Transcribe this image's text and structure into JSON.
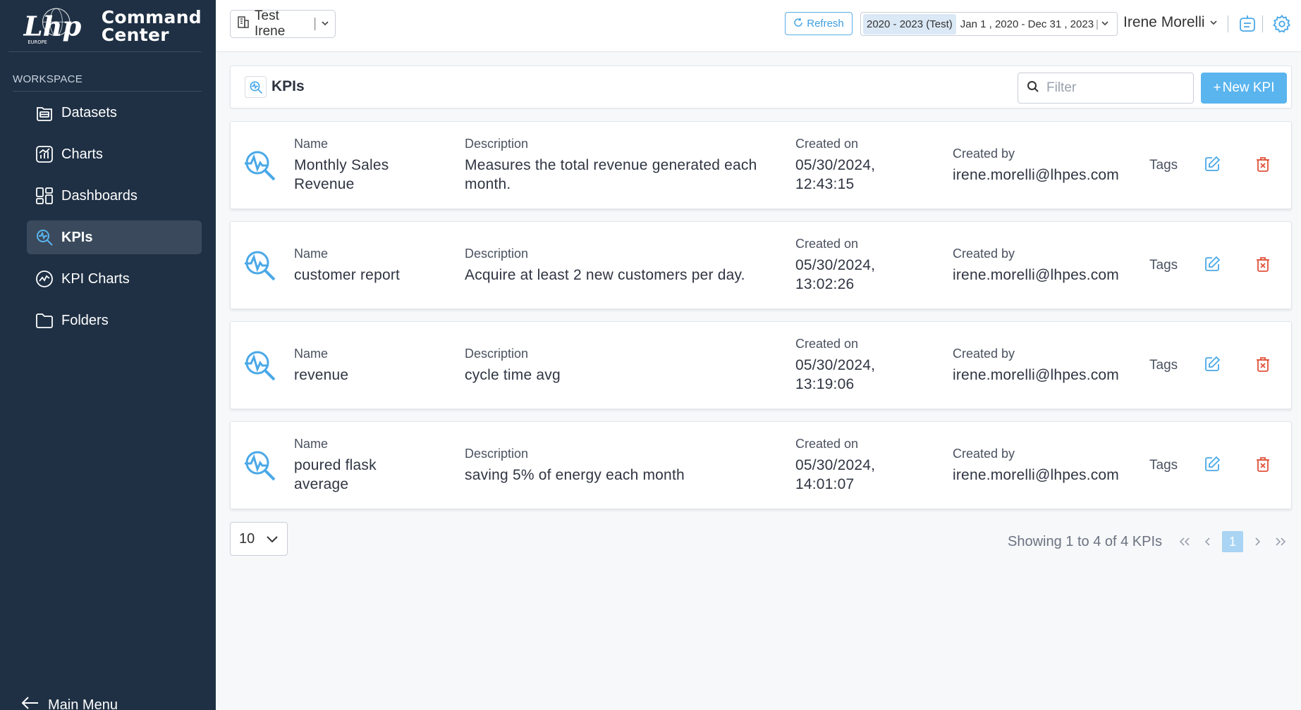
{
  "app": {
    "brand": [
      "Command",
      "Center"
    ],
    "logo_text": "Lhp EUROPE"
  },
  "sidebar": {
    "section_label": "WORKSPACE",
    "items": [
      {
        "label": "Datasets",
        "icon": "datasets-icon",
        "active": false
      },
      {
        "label": "Charts",
        "icon": "chart-icon",
        "active": false
      },
      {
        "label": "Dashboards",
        "icon": "dashboard-icon",
        "active": false
      },
      {
        "label": "KPIs",
        "icon": "kpi-icon",
        "active": true
      },
      {
        "label": "KPI Charts",
        "icon": "kpi-chart-icon",
        "active": false
      },
      {
        "label": "Folders",
        "icon": "folder-icon",
        "active": false
      }
    ],
    "main_menu": "Main Menu"
  },
  "topbar": {
    "tenant": "Test Irene",
    "refresh": "Refresh",
    "range_badge": "2020 - 2023 (Test)",
    "range_dates": "Jan 1 , 2020 - Dec 31 , 2023",
    "user": "Irene Morelli"
  },
  "header": {
    "title": "KPIs",
    "filter_placeholder": "Filter",
    "new_button": "New KPI"
  },
  "columns": {
    "name": "Name",
    "description": "Description",
    "created_on": "Created on",
    "created_by": "Created by",
    "tags": "Tags"
  },
  "kpis": [
    {
      "name": "Monthly Sales Revenue",
      "description": "Measures the total revenue generated each month.",
      "created_on": "05/30/2024, 12:43:15",
      "created_by": "irene.morelli@lhpes.com"
    },
    {
      "name": "customer report",
      "description": "Acquire at least 2 new customers per day.",
      "created_on": "05/30/2024, 13:02:26",
      "created_by": "irene.morelli@lhpes.com"
    },
    {
      "name": "revenue",
      "description": "cycle time avg",
      "created_on": "05/30/2024, 13:19:06",
      "created_by": "irene.morelli@lhpes.com"
    },
    {
      "name": "poured flask average",
      "description": "saving 5% of energy each month",
      "created_on": "05/30/2024, 14:01:07",
      "created_by": "irene.morelli@lhpes.com"
    }
  ],
  "footer": {
    "page_size": "10",
    "showing": "Showing 1 to 4 of 4 KPIs",
    "current_page": "1"
  },
  "colors": {
    "sidebar_bg": "#1f3044",
    "accent": "#5ab4ee",
    "delete": "#e0513a"
  }
}
